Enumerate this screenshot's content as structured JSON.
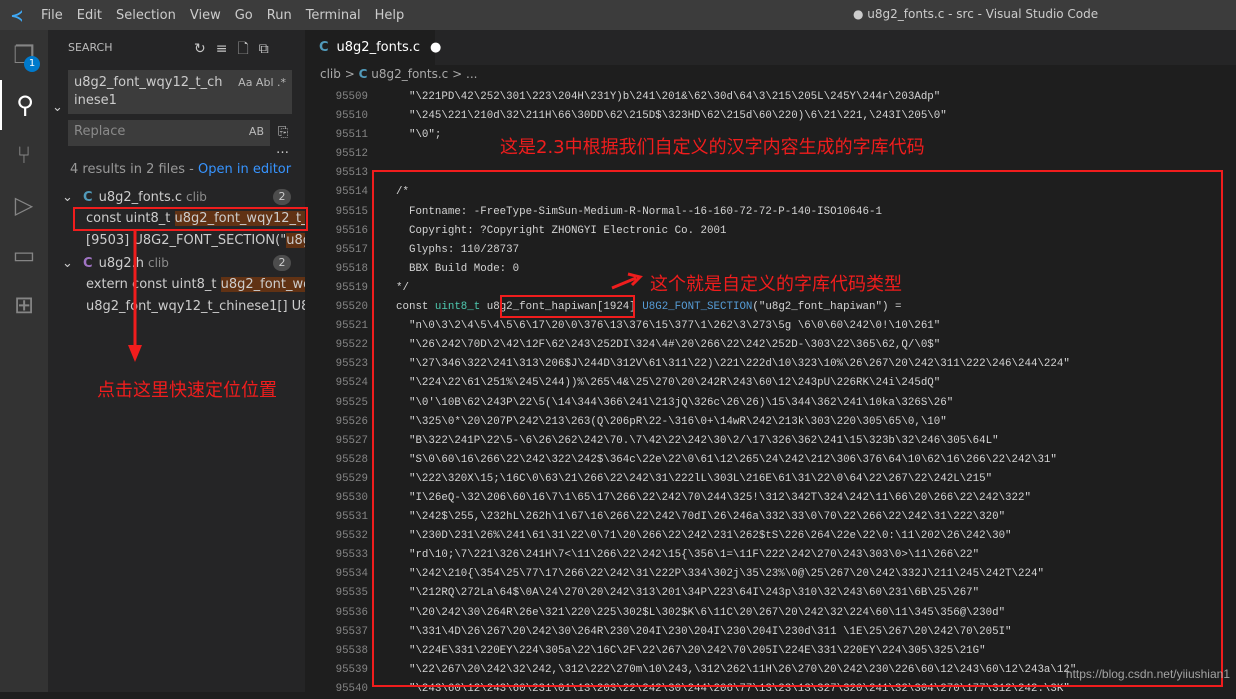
{
  "titlebar": {
    "menu": [
      "File",
      "Edit",
      "Selection",
      "View",
      "Go",
      "Run",
      "Terminal",
      "Help"
    ],
    "title": "● u8g2_fonts.c - src - Visual Studio Code"
  },
  "activity": {
    "explorer_badge": "1"
  },
  "sidebar": {
    "title": "SEARCH",
    "search_value": "u8g2_font_wqy12_t_chinese1",
    "search_options": "Aa  Abl  .*",
    "replace_placeholder": "Replace",
    "replace_option": "AB",
    "summary": "4 results in 2 files - ",
    "open_in_editor": "Open in editor",
    "files": [
      {
        "name": "u8g2_fonts.c",
        "folder": "clib",
        "count": "2",
        "matches": [
          {
            "pre": "const uint8_t ",
            "hit": "u8g2_font_wqy12_t_ch..."
          },
          {
            "pre": "[9503] U8G2_FONT_SECTION(\"",
            "hit": "u8g2..."
          }
        ]
      },
      {
        "name": "u8g2.h",
        "folder": "clib",
        "count": "2",
        "matches": [
          {
            "pre": "extern const uint8_t ",
            "hit": "u8g2_font_wqy..."
          },
          {
            "pre": "u8g2_font_wqy12_t_chinese1[] U8G...",
            "hit": ""
          }
        ]
      }
    ]
  },
  "editor": {
    "tab": "u8g2_fonts.c",
    "breadcrumb": [
      "clib",
      ">",
      "u8g2_fonts.c",
      ">",
      "..."
    ],
    "lines": [
      {
        "n": "95509",
        "t": "  \"\\221PD\\42\\252\\301\\223\\204H\\231Y)b\\241\\201&\\62\\30d\\64\\3\\215\\205L\\245Y\\244r\\203Adp\""
      },
      {
        "n": "95510",
        "t": "  \"\\245\\221\\210d\\32\\211H\\66\\30DD\\62\\215D$\\323HD\\62\\215d\\60\\220)\\6\\21\\221,\\243I\\205\\0\""
      },
      {
        "n": "95511",
        "t": "  \"\\0\";"
      },
      {
        "n": "95512",
        "t": ""
      },
      {
        "n": "95513",
        "t": ""
      },
      {
        "n": "95514",
        "t": "/*"
      },
      {
        "n": "95515",
        "t": "  Fontname: -FreeType-SimSun-Medium-R-Normal--16-160-72-72-P-140-ISO10646-1"
      },
      {
        "n": "95516",
        "t": "  Copyright: ?Copyright ZHONGYI Electronic Co. 2001"
      },
      {
        "n": "95517",
        "t": "  Glyphs: 110/28737"
      },
      {
        "n": "95518",
        "t": "  BBX Build Mode: 0"
      },
      {
        "n": "95519",
        "t": "*/"
      },
      {
        "n": "95520",
        "parts": [
          "const ",
          "uint8_t",
          " ",
          "u8g2_font_hapiwan",
          "[1924] ",
          "U8G2_FONT_SECTION",
          "(\"u8g2_font_hapiwan\") ="
        ]
      },
      {
        "n": "95521",
        "t": "  \"n\\0\\3\\2\\4\\5\\4\\5\\6\\17\\20\\0\\376\\13\\376\\15\\377\\1\\262\\3\\273\\5g \\6\\0\\60\\242\\0!\\10\\261\""
      },
      {
        "n": "95522",
        "t": "  \"\\26\\242\\70D\\2\\42\\12F\\62\\243\\252DI\\324\\4#\\20\\266\\22\\242\\252D-\\303\\22\\365\\62,Q/\\0$\""
      },
      {
        "n": "95523",
        "t": "  \"\\27\\346\\322\\241\\313\\206$J\\244D\\312V\\61\\311\\22)\\221\\222d\\10\\323\\10%\\26\\267\\20\\242\\311\\222\\246\\244\\224\""
      },
      {
        "n": "95524",
        "t": "  \"\\224\\22\\61\\251%\\245\\244))%\\265\\4&\\25\\270\\20\\242R\\243\\60\\12\\243pU\\226RK\\24i\\245dQ\""
      },
      {
        "n": "95525",
        "t": "  \"\\0'\\10B\\62\\243P\\22\\5(\\14\\344\\366\\241\\213jQ\\326c\\26\\26)\\15\\344\\362\\241\\10ka\\326S\\26\""
      },
      {
        "n": "95526",
        "t": "  \"\\325\\0*\\20\\207P\\242\\213\\263(Q\\206pR\\22-\\316\\0+\\14wR\\242\\213k\\303\\220\\305\\65\\0,\\10\""
      },
      {
        "n": "95527",
        "t": "  \"B\\322\\241P\\22\\5-\\6\\26\\262\\242\\70.\\7\\42\\22\\242\\30\\2/\\17\\326\\362\\241\\15\\323b\\32\\246\\305\\64L\""
      },
      {
        "n": "95528",
        "t": "  \"S\\0\\60\\16\\266\\22\\242\\322\\242$\\364c\\22e\\22\\0\\61\\12\\265\\24\\242\\212\\306\\376\\64\\10\\62\\16\\266\\22\\242\\31\""
      },
      {
        "n": "95529",
        "t": "  \"\\222\\320X\\15;\\16C\\0\\63\\21\\266\\22\\242\\31\\222lL\\303L\\216E\\61\\31\\22\\0\\64\\22\\267\\22\\242L\\215\""
      },
      {
        "n": "95530",
        "t": "  \"I\\26eQ-\\32\\206\\60\\16\\7\\1\\65\\17\\266\\22\\242\\70\\244\\325!\\312\\342T\\324\\242\\11\\66\\20\\266\\22\\242\\322\""
      },
      {
        "n": "95531",
        "t": "  \"\\242$\\255,\\232hL\\262h\\1\\67\\16\\266\\22\\242\\70dI\\26\\246a\\332\\33\\0\\70\\22\\266\\22\\242\\31\\222\\320\""
      },
      {
        "n": "95532",
        "t": "  \"\\230D\\231\\26%\\241\\61\\31\\22\\0\\71\\20\\266\\22\\242\\231\\262$tS\\226\\264\\22e\\22\\0:\\11\\202\\26\\242\\30\""
      },
      {
        "n": "95533",
        "t": "  \"rd\\10;\\7\\221\\326\\241H\\7<\\11\\266\\22\\242\\15{\\356\\1=\\11F\\222\\242\\270\\243\\303\\0>\\11\\266\\22\""
      },
      {
        "n": "95534",
        "t": "  \"\\242\\210{\\354\\25\\77\\17\\266\\22\\242\\31\\222P\\334\\302j\\35\\23%\\0@\\25\\267\\20\\242\\332J\\211\\245\\242T\\224\""
      },
      {
        "n": "95535",
        "t": "  \"\\212RQ\\272La\\64$\\0A\\24\\270\\20\\242\\313\\201\\34P\\223\\64I\\243p\\310\\32\\243\\60\\231\\6B\\25\\267\""
      },
      {
        "n": "95536",
        "t": "  \"\\20\\242\\30\\264R\\26e\\321\\220\\225\\302$L\\302$K\\6\\11C\\20\\267\\20\\242\\32\\224\\60\\11\\345\\356@\\230d\""
      },
      {
        "n": "95537",
        "t": "  \"\\331\\4D\\26\\267\\20\\242\\30\\264R\\230\\204I\\230\\204I\\230\\204I\\230d\\311 \\1E\\25\\267\\20\\242\\70\\205I\""
      },
      {
        "n": "95538",
        "t": "  \"\\224E\\331\\220EY\\224\\305a\\22\\16C\\2F\\22\\267\\20\\242\\70\\205I\\224E\\331\\220EY\\224\\305\\325\\21G\""
      },
      {
        "n": "95539",
        "t": "  \"\\22\\267\\20\\242\\32\\242,\\312\\222\\270m\\10\\243,\\312\\262\\11H\\26\\270\\20\\242\\230\\226\\60\\12\\243\\60\\12\\243a\\12\""
      },
      {
        "n": "95540",
        "t": "  \"\\243\\60\\12\\243\\60\\231\\01\\13\\203\\22\\242\\30\\244\\206\\77\\13\\23\\13\\327\\320\\241\\32\\304\\270\\177\\312\\242:\\3K\""
      }
    ]
  },
  "annotations": {
    "top_note": "这是2.3中根据我们自定义的汉字内容生成的字库代码",
    "type_note": "这个就是自定义的字库代码类型",
    "left_note": "点击这里快速定位位置",
    "color": "#f01d1d"
  },
  "watermark": "https://blog.csdn.net/yiiushian1"
}
